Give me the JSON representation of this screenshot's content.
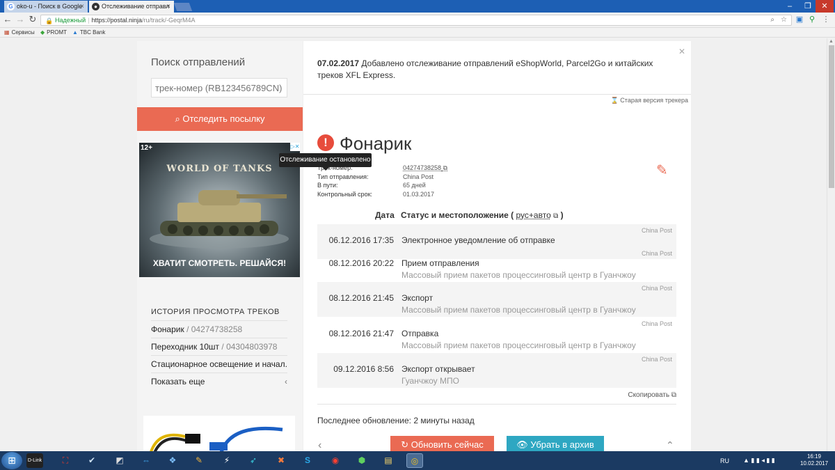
{
  "browser": {
    "tabs": [
      {
        "title": "oko-u - Поиск в Google",
        "icon": "google-g-icon"
      },
      {
        "title": "Отслеживание отправл",
        "icon": "postal-ninja-icon"
      }
    ],
    "address": {
      "secure_label": "Надежный",
      "url_host": "https://postal.ninja",
      "url_path": "/ru/track/-GeqrM4A"
    },
    "bookmarks": [
      {
        "label": "Сервисы",
        "icon": "apps-grid-icon"
      },
      {
        "label": "PROMT",
        "icon": "promt-icon"
      },
      {
        "label": "TBC Bank",
        "icon": "tbc-icon"
      }
    ]
  },
  "sidebar": {
    "search_title": "Поиск отправлений",
    "track_placeholder": "трек-номер (RB123456789CN)",
    "track_button": "Отследить посылку",
    "ad": {
      "age": "12+",
      "brand": "WORLD OF TANKS",
      "cta": "ХВАТИТ СМОТРЕТЬ. РЕШАЙСЯ!"
    },
    "history_title": "ИСТОРИЯ ПРОСМОТРА ТРЕКОВ",
    "history": [
      {
        "name": "Фонарик",
        "sep": " / ",
        "track": "04274738258"
      },
      {
        "name": "Переходник 10шт",
        "sep": " / ",
        "track": "04304803978"
      },
      {
        "name": "Стационарное освещение и начал...",
        "sep": "",
        "track": ""
      }
    ],
    "show_more": "Показать еще"
  },
  "main": {
    "news_date": "07.02.2017",
    "news_text": " Добавлено отслеживание отправлений eShopWorld, Parcel2Go и китайских треков XFL Express.",
    "old_version": "Старая версия трекера",
    "tooltip": "Отслеживание остановлено",
    "parcel_title": "Фонарик",
    "meta": [
      {
        "key": "Трек-номер:",
        "value": "04274738258"
      },
      {
        "key": "Тип отправления:",
        "value": "China Post"
      },
      {
        "key": "В пути:",
        "value": "65 дней"
      },
      {
        "key": "Контрольный срок:",
        "value": "01.03.2017"
      }
    ],
    "table_header": {
      "date": "Дата",
      "status": "Статус и местоположение",
      "paren_open": " ( ",
      "lang": "рус+авто",
      "paren_close": " )"
    },
    "events": [
      {
        "source": "China Post",
        "date": "06.12.2016 17:35",
        "status": "Электронное уведомление об отправке",
        "location": ""
      },
      {
        "source": "China Post",
        "date": "08.12.2016 20:22",
        "status": "Прием отправления",
        "location": "Массовый прием пакетов процессинговый центр в Гуанчжоу"
      },
      {
        "source": "China Post",
        "date": "08.12.2016 21:45",
        "status": "Экспорт",
        "location": "Массовый прием пакетов процессинговый центр в Гуанчжоу"
      },
      {
        "source": "China Post",
        "date": "08.12.2016 21:47",
        "status": "Отправка",
        "location": "Массовый прием пакетов процессинговый центр в Гуанчжоу"
      },
      {
        "source": "China Post",
        "date": "09.12.2016 8:56",
        "status": "Экспорт открывает",
        "location": "Гуанчжоу МПО"
      }
    ],
    "copy_label": "Скопировать",
    "last_update": "Последнее обновление: 2 минуты назад",
    "update_button": "Обновить сейчас",
    "archive_button": "Убрать в архив"
  },
  "taskbar": {
    "lang": "RU",
    "time": "16:19",
    "date": "10.02.2017"
  },
  "colors": {
    "accent": "#ea6a53",
    "archive": "#2ea7c2",
    "warning": "#e74c3c"
  }
}
